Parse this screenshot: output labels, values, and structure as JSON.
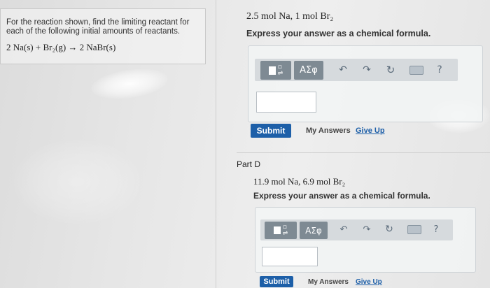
{
  "problem": {
    "text": "For the reaction shown, find the limiting reactant for each of the following initial amounts of reactants.",
    "reaction": "2 Na(s) + Br₂(g) → 2 NaBr(s)"
  },
  "part_c": {
    "quantities": "2.5 mol Na, 1 mol Br₂",
    "instruction": "Express your answer as a chemical formula.",
    "toolbar": {
      "greek_label": "ΑΣφ",
      "icons": [
        "templates-icon",
        "greek-symbols-icon",
        "undo-icon",
        "redo-icon",
        "reset-icon",
        "keyboard-icon",
        "help-icon"
      ],
      "help_label": "?"
    },
    "answer_value": "",
    "submit_label": "Submit",
    "my_answers_label": "My Answers",
    "give_up_label": "Give Up"
  },
  "part_d": {
    "title": "Part D",
    "quantities": "11.9 mol Na, 6.9 mol Br₂",
    "instruction": "Express your answer as a chemical formula.",
    "toolbar": {
      "greek_label": "ΑΣφ",
      "icons": [
        "templates-icon",
        "greek-symbols-icon",
        "undo-icon",
        "redo-icon",
        "reset-icon",
        "keyboard-icon",
        "help-icon"
      ],
      "help_label": "?"
    },
    "answer_value": "",
    "submit_label": "Submit",
    "my_answers_label": "My Answers",
    "give_up_label": "Give Up"
  },
  "colors": {
    "submit_bg": "#1d5fa8",
    "link": "#1d5fa8",
    "toolbar_button": "#7e8a93"
  }
}
